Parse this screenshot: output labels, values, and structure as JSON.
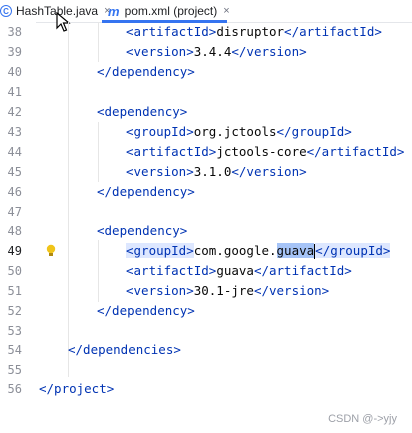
{
  "tabs": [
    {
      "label": "HashTable.java",
      "icon": "class-icon",
      "close": "×"
    },
    {
      "label": "pom.xml (project)",
      "icon": "maven-icon",
      "close": "×"
    }
  ],
  "editor": {
    "line_numbers": [
      "38",
      "39",
      "40",
      "41",
      "42",
      "43",
      "44",
      "45",
      "46",
      "47",
      "48",
      "49",
      "50",
      "51",
      "52",
      "53",
      "54",
      "55",
      "56"
    ],
    "lines": {
      "l38": {
        "open": "<artifactId>",
        "text": "disruptor",
        "close": "</artifactId>"
      },
      "l39": {
        "open": "<version>",
        "text": "3.4.4",
        "close": "</version>"
      },
      "l40": {
        "close": "</dependency>"
      },
      "l42": {
        "open": "<dependency>"
      },
      "l43": {
        "open": "<groupId>",
        "text": "org.jctools",
        "close": "</groupId>"
      },
      "l44": {
        "open": "<artifactId>",
        "text": "jctools-core",
        "close": "</artifactId>"
      },
      "l45": {
        "open": "<version>",
        "text": "3.1.0",
        "close": "</version>"
      },
      "l46": {
        "close": "</dependency>"
      },
      "l48": {
        "open": "<dependency>"
      },
      "l49": {
        "open": "<groupId>",
        "text_pre": "com.google.",
        "text_sel": "guava",
        "close": "</groupId>"
      },
      "l50": {
        "open": "<artifactId>",
        "text": "guava",
        "close": "</artifactId>"
      },
      "l51": {
        "open": "<version>",
        "text": "30.1-jre",
        "close": "</version>"
      },
      "l52": {
        "close": "</dependency>"
      },
      "l54": {
        "close": "</dependencies>"
      },
      "l56": {
        "close": "</project>"
      }
    }
  },
  "watermark": "CSDN @->yjy"
}
